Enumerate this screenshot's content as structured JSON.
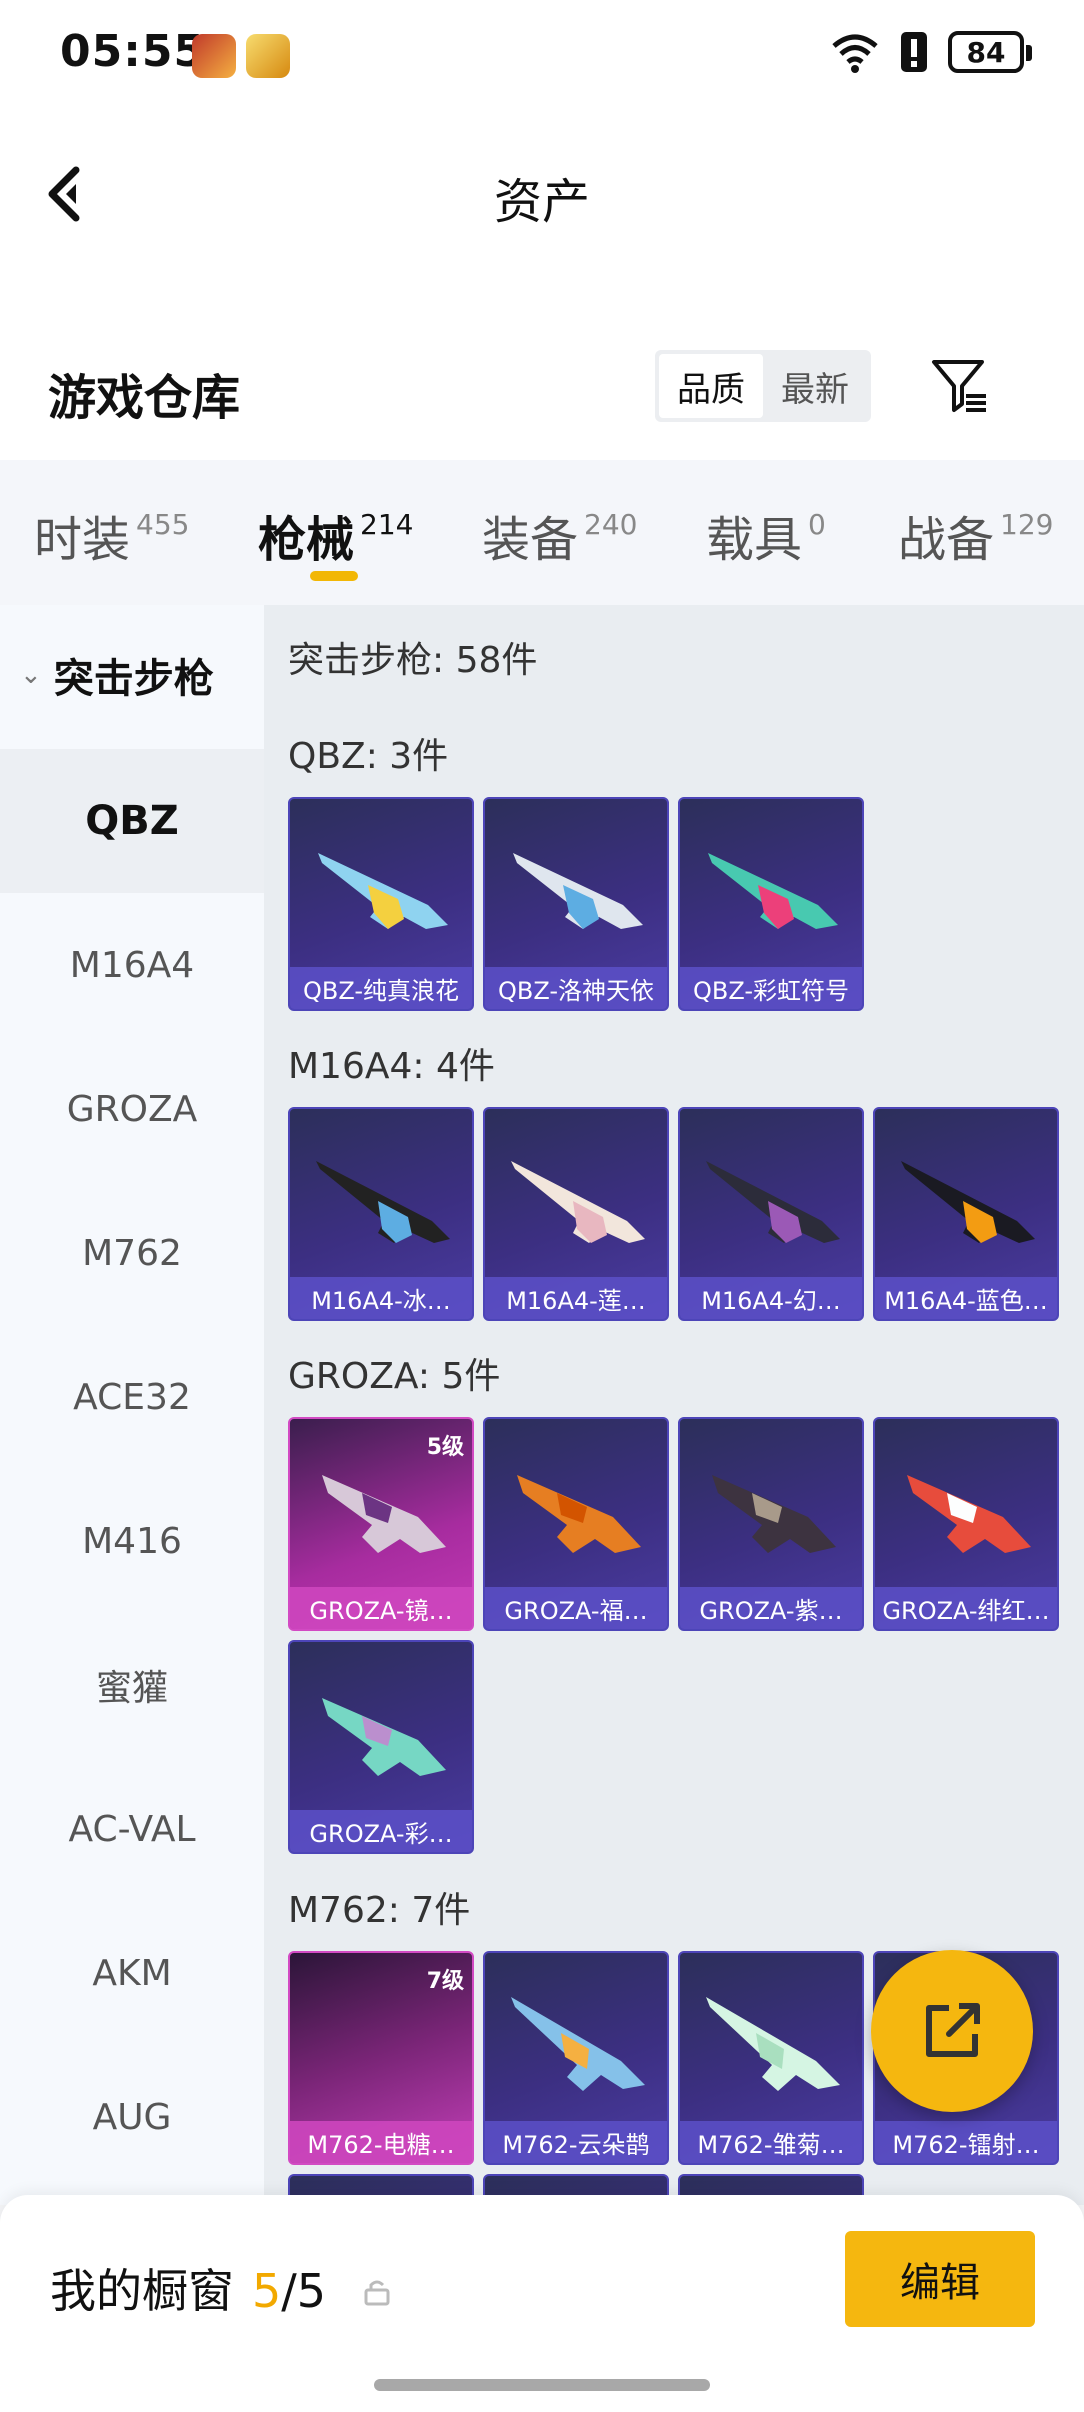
{
  "status_bar": {
    "time": "05:55",
    "battery": "84",
    "icons": [
      "game-app-icon-1",
      "game-app-icon-2",
      "wifi-icon",
      "alert-icon",
      "battery-icon"
    ]
  },
  "nav": {
    "title": "资产"
  },
  "warehouse": {
    "title": "游戏仓库",
    "sort_options": [
      "品质",
      "最新"
    ],
    "sort_selected": "品质"
  },
  "tabs": [
    {
      "label": "时装",
      "count": "455"
    },
    {
      "label": "枪械",
      "count": "214",
      "active": true
    },
    {
      "label": "装备",
      "count": "240"
    },
    {
      "label": "载具",
      "count": "0"
    },
    {
      "label": "战备",
      "count": "129"
    }
  ],
  "sidebar": {
    "header": "突击步枪",
    "items": [
      "QBZ",
      "M16A4",
      "GROZA",
      "M762",
      "ACE32",
      "M416",
      "蜜獾",
      "AC-VAL",
      "AKM",
      "AUG"
    ],
    "selected": "QBZ"
  },
  "content": {
    "summary": "突击步枪: 58件",
    "sections": [
      {
        "title": "QBZ: 3件",
        "items": [
          {
            "label": "QBZ-纯真浪花"
          },
          {
            "label": "QBZ-洛神天依"
          },
          {
            "label": "QBZ-彩虹符号"
          }
        ]
      },
      {
        "title": "M16A4: 4件",
        "items": [
          {
            "label": "M16A4-冰…"
          },
          {
            "label": "M16A4-莲…"
          },
          {
            "label": "M16A4-幻…"
          },
          {
            "label": "M16A4-蓝色…"
          }
        ]
      },
      {
        "title": "GROZA: 5件",
        "items": [
          {
            "label": "GROZA-镜…",
            "level": "5级"
          },
          {
            "label": "GROZA-福…"
          },
          {
            "label": "GROZA-紫…"
          },
          {
            "label": "GROZA-绯红…"
          },
          {
            "label": "GROZA-彩…"
          }
        ]
      },
      {
        "title": "M762: 7件",
        "items": [
          {
            "label": "M762-电糖…",
            "level": "7级"
          },
          {
            "label": "M762-云朵鹊"
          },
          {
            "label": "M762-雏菊…"
          },
          {
            "label": "M762-镭射…"
          }
        ]
      }
    ]
  },
  "showcase": {
    "label": "我的橱窗",
    "count_current": "5",
    "count_sep": "/",
    "count_total": "5",
    "edit_label": "编辑"
  },
  "colors": {
    "accent": "#f5b70f",
    "card_purple": "#4b3ca3",
    "card_pink": "#c439b6"
  }
}
